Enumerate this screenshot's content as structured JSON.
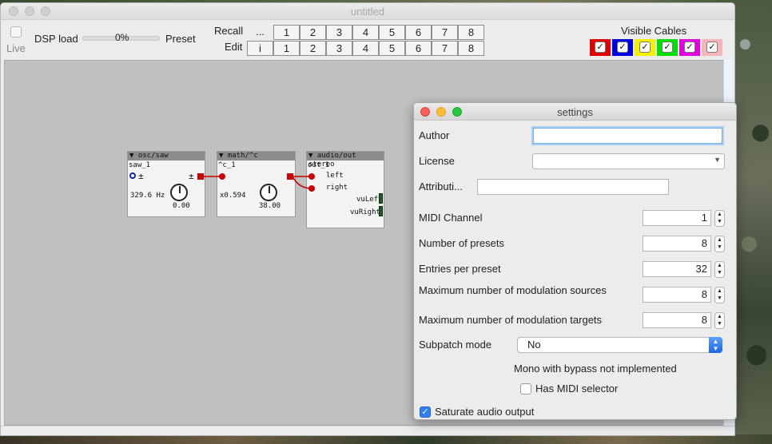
{
  "window": {
    "title": "untitled"
  },
  "toolbar": {
    "live_label": "Live",
    "dsp_label": "DSP load",
    "dsp_value": "0%",
    "preset_label": "Preset",
    "recall_label": "Recall",
    "edit_label": "Edit",
    "recall_buttons": [
      "...",
      "1",
      "2",
      "3",
      "4",
      "5",
      "6",
      "7",
      "8"
    ],
    "edit_buttons": [
      "i",
      "1",
      "2",
      "3",
      "4",
      "5",
      "6",
      "7",
      "8"
    ],
    "visible_cables_label": "Visible Cables",
    "cable_colors": [
      "#e00000",
      "#0000e0",
      "#f2f200",
      "#00e000",
      "#e000e0",
      "#f4b6b6"
    ],
    "cable_check_mark": "✓"
  },
  "patch": {
    "objects": [
      {
        "header": "▼ osc/saw",
        "instance": "saw_1",
        "value_label": "329.6 Hz",
        "knob_value": "0.00",
        "plus_minus": "±",
        "out_plus_minus": "±"
      },
      {
        "header": "▼ math/^c",
        "instance": "^c_1",
        "value_label": "x0.594",
        "knob_value": "38.00"
      },
      {
        "header": "▼ audio/out stereo",
        "instance": "out_1",
        "inlet_left": "left",
        "inlet_right": "right",
        "vu_left": "vuLeft",
        "vu_right": "vuRight"
      }
    ]
  },
  "settings": {
    "title": "settings",
    "author_label": "Author",
    "author_value": "",
    "license_label": "License",
    "license_value": "",
    "attribution_label": "Attributi...",
    "attribution_value": "",
    "midi_channel_label": "MIDI Channel",
    "midi_channel_value": "1",
    "num_presets_label": "Number of presets",
    "num_presets_value": "8",
    "entries_label": "Entries per preset",
    "entries_value": "32",
    "mod_sources_label": "Maximum number of modulation sources",
    "mod_sources_value": "8",
    "mod_targets_label": "Maximum number of modulation targets",
    "mod_targets_value": "8",
    "subpatch_label": "Subpatch mode",
    "subpatch_value": "No",
    "mono_note": "Mono with bypass not implemented",
    "has_midi_selector_label": "Has MIDI selector",
    "has_midi_selector_checked": false,
    "saturate_label": "Saturate audio output",
    "saturate_checked": true,
    "check_mark": "✓"
  }
}
